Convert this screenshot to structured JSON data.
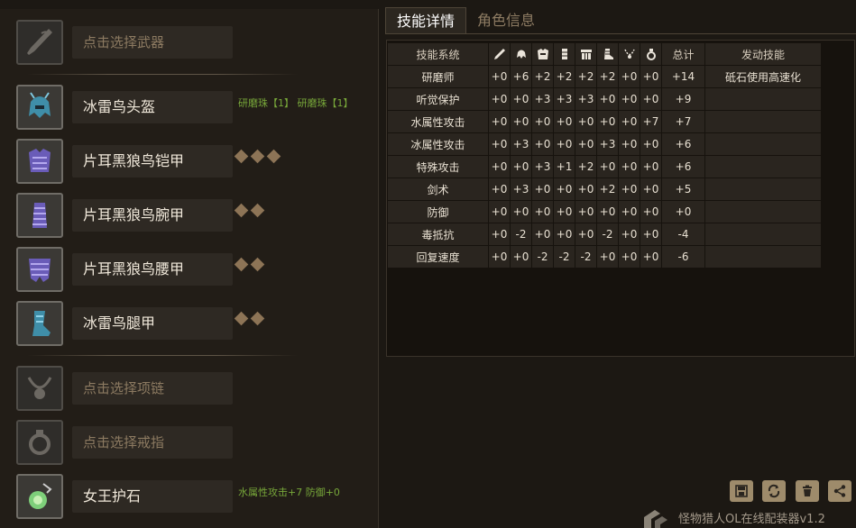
{
  "equipment": {
    "weapon": {
      "name": "点击选择武器",
      "icon": "weapon-icon"
    },
    "head": {
      "name": "冰雷鸟头盔",
      "icon": "helmet-icon",
      "extra": "研磨珠【1】 研磨珠【1】"
    },
    "chest": {
      "name": "片耳黑狼鸟铠甲",
      "icon": "chest-armor-icon",
      "slots": 3
    },
    "arms": {
      "name": "片耳黑狼鸟腕甲",
      "icon": "arm-armor-icon",
      "slots": 2
    },
    "waist": {
      "name": "片耳黑狼鸟腰甲",
      "icon": "waist-armor-icon",
      "slots": 2
    },
    "legs": {
      "name": "冰雷鸟腿甲",
      "icon": "leg-armor-icon",
      "slots": 2
    },
    "necklace": {
      "name": "点击选择项链",
      "icon": "necklace-icon"
    },
    "ring": {
      "name": "点击选择戒指",
      "icon": "ring-icon"
    },
    "charm": {
      "name": "女王护石",
      "icon": "charm-icon",
      "extra": "水属性攻击+7 防御+0"
    }
  },
  "tabs": [
    {
      "label": "技能详情",
      "active": true
    },
    {
      "label": "角色信息",
      "active": false
    }
  ],
  "skill_table": {
    "headers": {
      "system": "技能系统",
      "total": "总计",
      "activated": "发动技能",
      "icons": [
        "weapon-icon",
        "helmet-icon",
        "chest-armor-icon",
        "arm-armor-icon",
        "waist-armor-icon",
        "leg-armor-icon",
        "necklace-icon",
        "ring-icon"
      ]
    },
    "rows": [
      {
        "name": "研磨师",
        "values": [
          "+0",
          "+6",
          "+2",
          "+2",
          "+2",
          "+2",
          "+0",
          "+0"
        ],
        "total": "+14",
        "skill": "砥石使用高速化"
      },
      {
        "name": "听觉保护",
        "values": [
          "+0",
          "+0",
          "+3",
          "+3",
          "+3",
          "+0",
          "+0",
          "+0"
        ],
        "total": "+9",
        "skill": ""
      },
      {
        "name": "水属性攻击",
        "values": [
          "+0",
          "+0",
          "+0",
          "+0",
          "+0",
          "+0",
          "+0",
          "+7"
        ],
        "total": "+7",
        "skill": ""
      },
      {
        "name": "冰属性攻击",
        "values": [
          "+0",
          "+3",
          "+0",
          "+0",
          "+0",
          "+3",
          "+0",
          "+0"
        ],
        "total": "+6",
        "skill": ""
      },
      {
        "name": "特殊攻击",
        "values": [
          "+0",
          "+0",
          "+3",
          "+1",
          "+2",
          "+0",
          "+0",
          "+0"
        ],
        "total": "+6",
        "skill": ""
      },
      {
        "name": "剑术",
        "values": [
          "+0",
          "+3",
          "+0",
          "+0",
          "+0",
          "+2",
          "+0",
          "+0"
        ],
        "total": "+5",
        "skill": ""
      },
      {
        "name": "防御",
        "values": [
          "+0",
          "+0",
          "+0",
          "+0",
          "+0",
          "+0",
          "+0",
          "+0"
        ],
        "total": "+0",
        "skill": ""
      },
      {
        "name": "毒抵抗",
        "values": [
          "+0",
          "-2",
          "+0",
          "+0",
          "+0",
          "-2",
          "+0",
          "+0"
        ],
        "total": "-4",
        "skill": ""
      },
      {
        "name": "回复速度",
        "values": [
          "+0",
          "+0",
          "-2",
          "-2",
          "-2",
          "+0",
          "+0",
          "+0"
        ],
        "total": "-6",
        "skill": ""
      }
    ]
  },
  "actions": [
    "save-icon",
    "refresh-icon",
    "trash-icon",
    "share-icon"
  ],
  "footer": {
    "title": "怪物猎人OL在线配装器v1.2"
  },
  "colors": {
    "background": "#1c1813",
    "panel": "#221d17",
    "accent_green": "#78a83a",
    "diamond": "#8d7456"
  }
}
